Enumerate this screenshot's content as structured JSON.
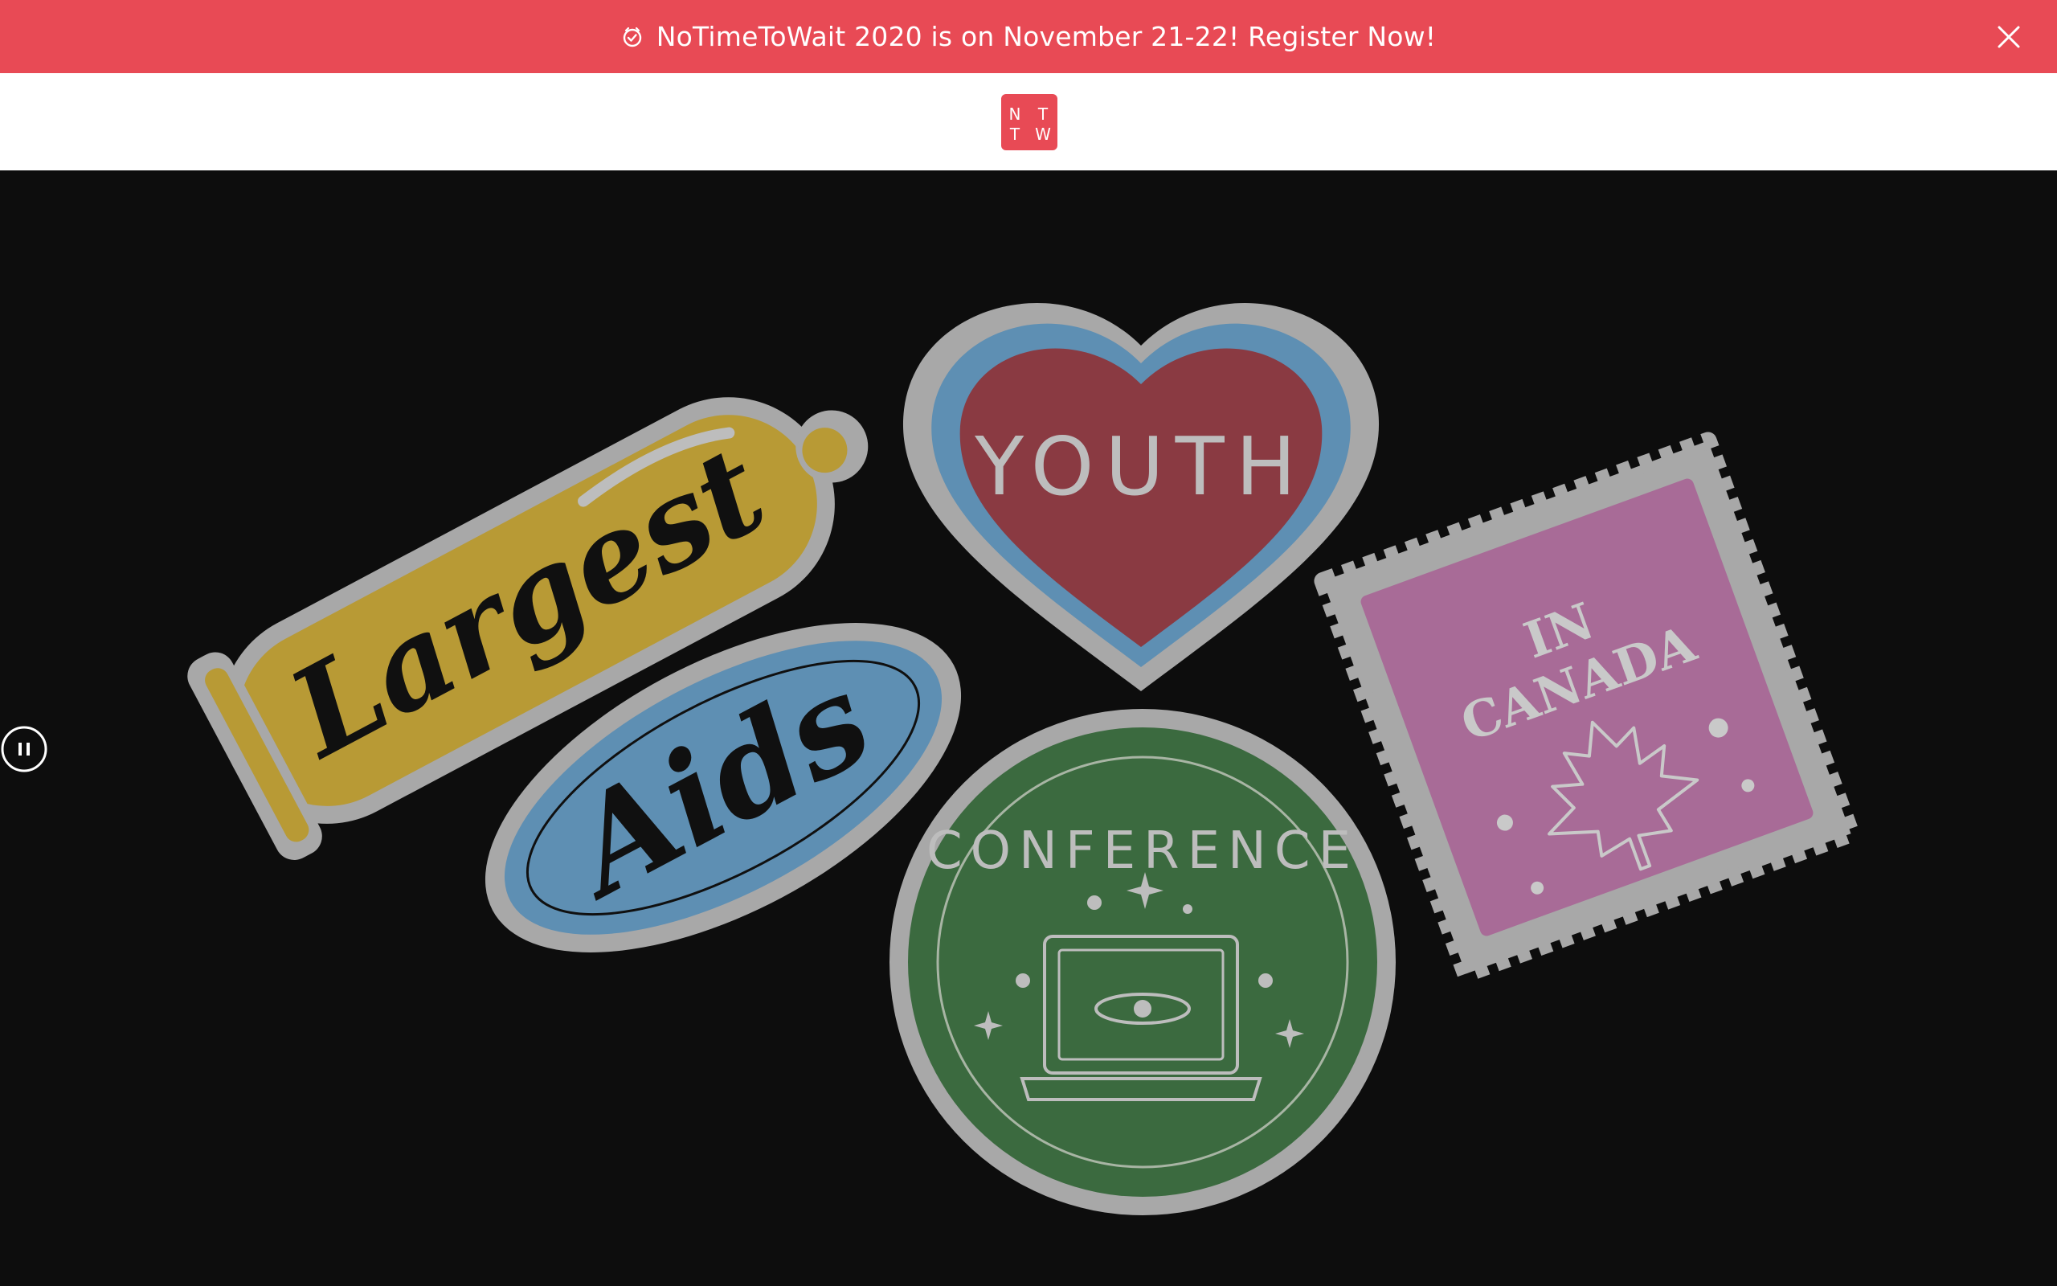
{
  "banner": {
    "icon": "clock-icon",
    "text": "NoTimeToWait 2020 is on November 21-22! Register Now!",
    "close_icon": "close-icon",
    "background": "#e84a55"
  },
  "header": {
    "logo_letters": [
      "N",
      "T",
      "T",
      "W"
    ],
    "logo_color": "#e84a55"
  },
  "hero": {
    "stickers": {
      "condom": "Largest",
      "oval": "Aids",
      "heart": "YOUTH",
      "circle": "CONFERENCE",
      "stamp_line1": "IN",
      "stamp_line2": "CANADA"
    },
    "pause_icon": "pause-icon"
  }
}
